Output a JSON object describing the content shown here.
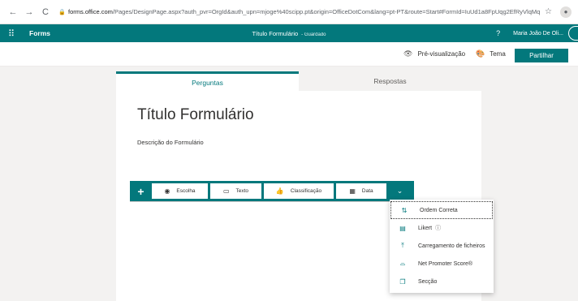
{
  "browser": {
    "back": "←",
    "forward": "→",
    "reload": "C",
    "url_host": "forms.office.com",
    "url_path": "/Pages/DesignPage.aspx?auth_pvr=OrgId&auth_upn=mjoge%40scipp.pt&origin=OfficeDotCom&lang=pt-PT&route=Start#FormId=IuUd1a8FpUqg2EfRyVlqMqz...",
    "star": "☆"
  },
  "app": {
    "brand": "Forms",
    "title": "Título Formulário",
    "saved": "- Guardado",
    "help": "?",
    "user_name": "Maria João De Oli..."
  },
  "toolbar": {
    "preview_label": "Pré-visualização",
    "theme_label": "Tema",
    "share_label": "Partilhar"
  },
  "tabs": {
    "questions": "Perguntas",
    "responses": "Respostas"
  },
  "form": {
    "title": "Título Formulário",
    "description": "Descrição do Formulário"
  },
  "question_bar": {
    "add": "+",
    "choice": "Escolha",
    "text": "Texto",
    "rating": "Classificação",
    "date": "Data"
  },
  "menu": {
    "items": [
      {
        "label": "Ordem Correta",
        "icon": "sort-icon"
      },
      {
        "label": "Likert",
        "icon": "grid-icon"
      },
      {
        "label": "Carregamento de ficheiros",
        "icon": "upload-icon"
      },
      {
        "label": "Net Promoter Score®",
        "icon": "gauge-icon"
      },
      {
        "label": "Secção",
        "icon": "section-icon"
      }
    ]
  },
  "colors": {
    "accent": "#03787c",
    "background": "#f3f2f1"
  }
}
